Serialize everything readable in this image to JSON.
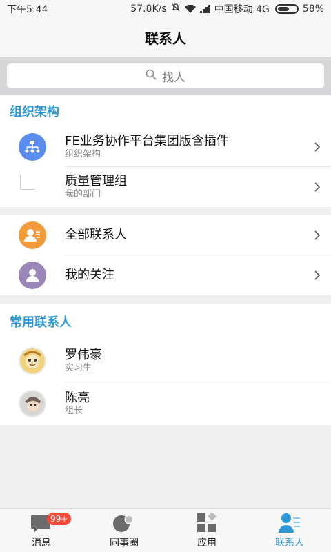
{
  "status_bar": {
    "time": "下午5:44",
    "speed": "57.8K/s",
    "carrier": "中国移动 4G",
    "battery": "58%"
  },
  "header": {
    "title": "联系人"
  },
  "search": {
    "placeholder": "找人"
  },
  "org": {
    "section_title": "组织架构",
    "items": [
      {
        "title": "FE业务协作平台集团版含插件",
        "subtitle": "组织架构"
      },
      {
        "title": "质量管理组",
        "subtitle": "我的部门"
      }
    ]
  },
  "quick": {
    "items": [
      {
        "title": "全部联系人"
      },
      {
        "title": "我的关注"
      }
    ]
  },
  "frequent": {
    "section_title": "常用联系人",
    "items": [
      {
        "name": "罗伟豪",
        "role": "实习生"
      },
      {
        "name": "陈亮",
        "role": "组长"
      }
    ]
  },
  "tabbar": {
    "badge": "99+",
    "tabs": [
      {
        "label": "消息"
      },
      {
        "label": "同事圈"
      },
      {
        "label": "应用"
      },
      {
        "label": "联系人"
      }
    ]
  },
  "colors": {
    "accent": "#2d9ad7",
    "org_icon": "#5b8def",
    "all_contacts_icon": "#f39a3a",
    "following_icon": "#9b86b8",
    "badge": "#f04a3b"
  }
}
